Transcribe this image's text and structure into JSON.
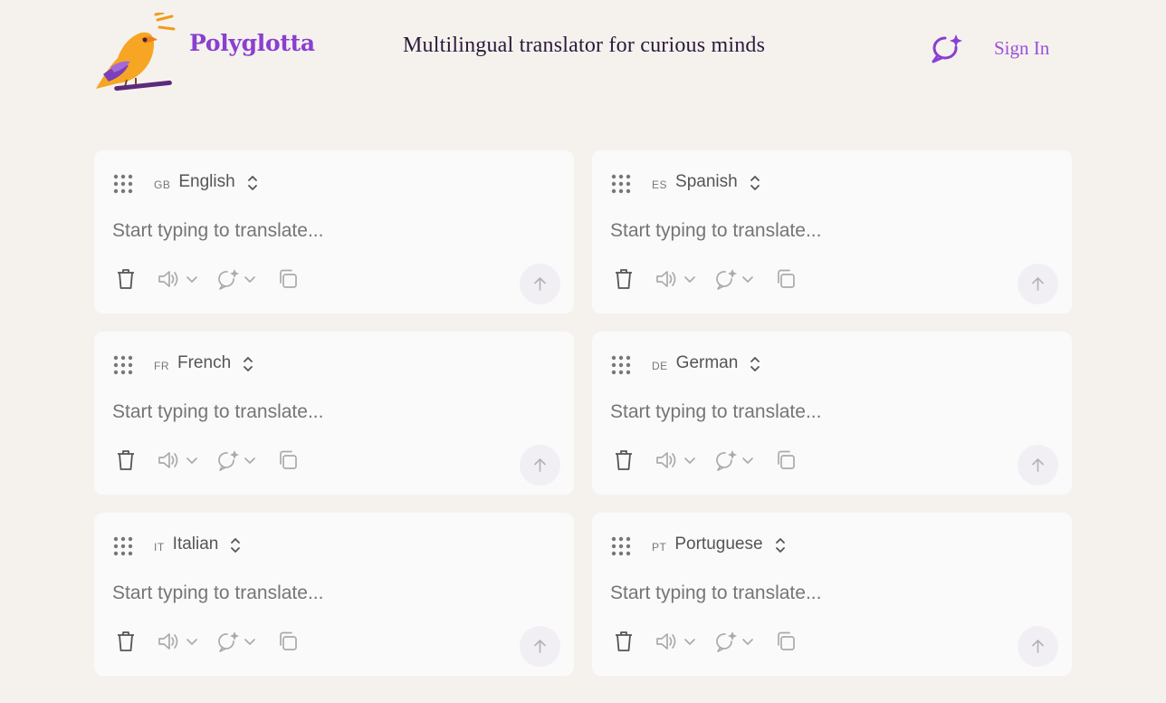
{
  "header": {
    "brand": "Polyglotta",
    "tagline": "Multilingual translator for curious minds",
    "signin_label": "Sign In",
    "accent_color": "#8a3fd0"
  },
  "cards": [
    {
      "code": "GB",
      "language": "English",
      "placeholder": "Start typing to translate..."
    },
    {
      "code": "ES",
      "language": "Spanish",
      "placeholder": "Start typing to translate..."
    },
    {
      "code": "FR",
      "language": "French",
      "placeholder": "Start typing to translate..."
    },
    {
      "code": "DE",
      "language": "German",
      "placeholder": "Start typing to translate..."
    },
    {
      "code": "IT",
      "language": "Italian",
      "placeholder": "Start typing to translate..."
    },
    {
      "code": "PT",
      "language": "Portuguese",
      "placeholder": "Start typing to translate..."
    }
  ],
  "icons": {
    "drag": "drag-handle-icon",
    "delete": "trash-icon",
    "speak": "speaker-icon",
    "ai": "ai-chat-sparkle-icon",
    "copy": "copy-icon",
    "send": "arrow-up-icon"
  }
}
